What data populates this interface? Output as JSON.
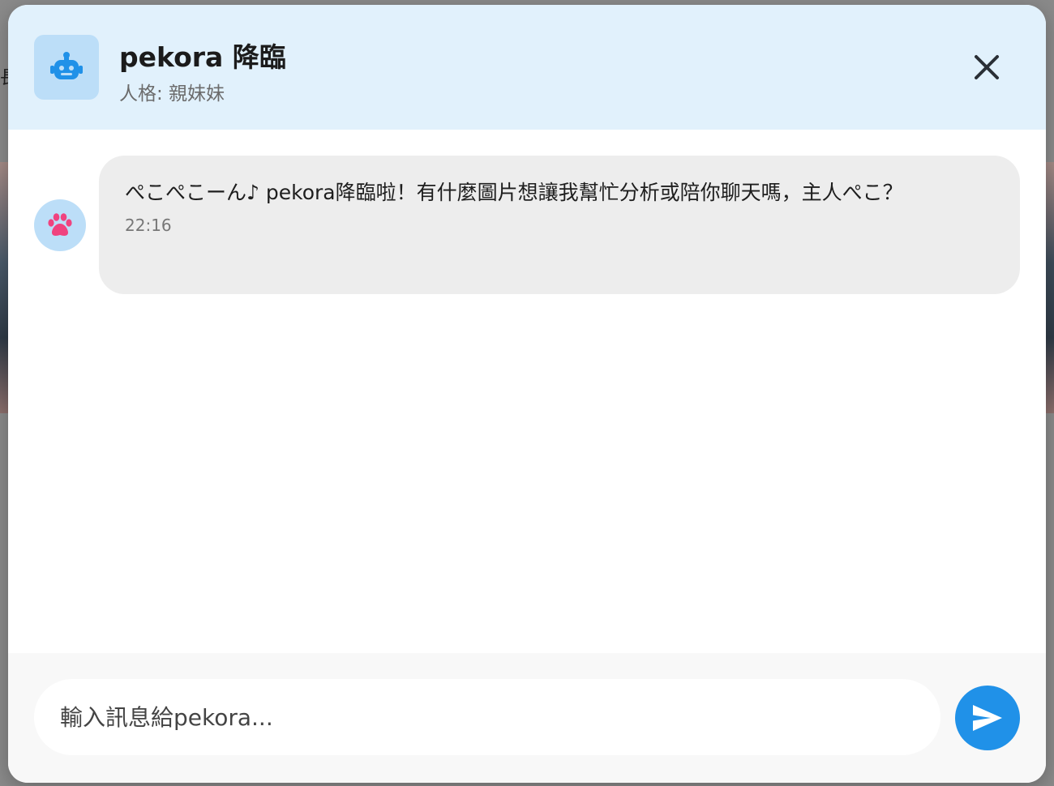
{
  "background": {
    "partial_char": "長"
  },
  "header": {
    "title": "pekora 降臨",
    "subtitle": "人格: 親妹妹",
    "icon": "robot-icon",
    "close_icon": "close-icon"
  },
  "messages": [
    {
      "sender": "assistant",
      "avatar_icon": "paw-icon",
      "text": "ぺこぺこーん♪ pekora降臨啦！有什麼圖片想讓我幫忙分析或陪你聊天嗎，主人ぺこ？",
      "time": "22:16"
    }
  ],
  "composer": {
    "value": "",
    "placeholder": "輸入訊息給pekora...",
    "send_icon": "send-icon"
  },
  "colors": {
    "header_bg": "#e1f1fc",
    "icon_bg": "#bcdef8",
    "accent": "#2091e8",
    "paw": "#f0427f",
    "bubble_bg": "#ededed",
    "input_bar_bg": "#f8f8f8"
  }
}
